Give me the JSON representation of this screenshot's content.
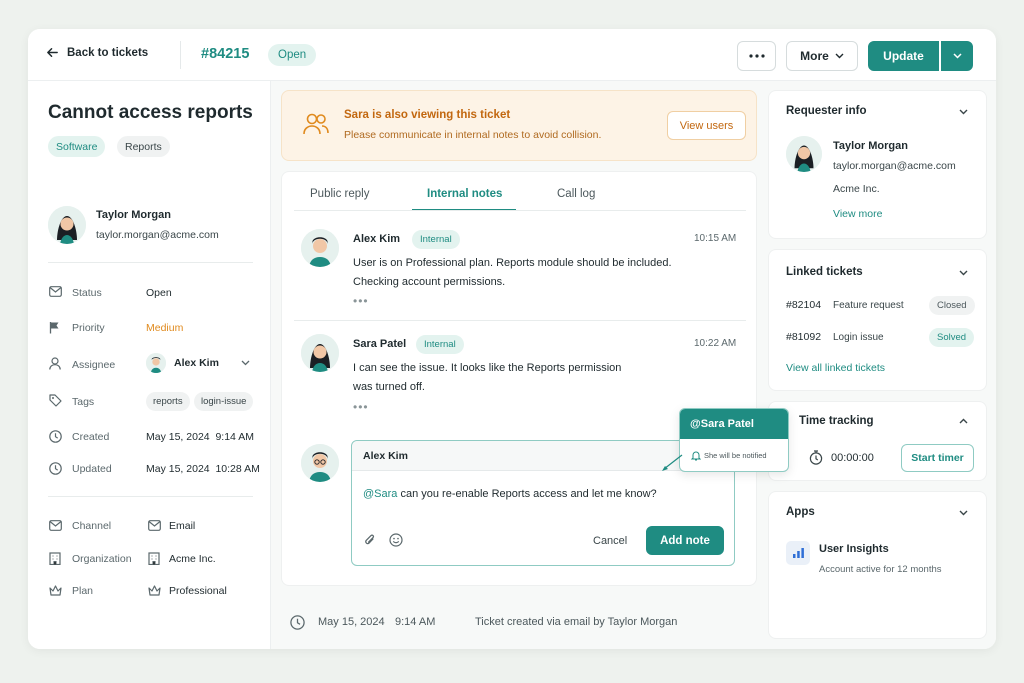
{
  "header": {
    "back_label": "Back to tickets",
    "ticket_id": "#84215",
    "status_badge": "Open",
    "more_label": "More",
    "update_label": "Update"
  },
  "ticket": {
    "title": "Cannot access reports",
    "tags": [
      "Software",
      "Reports"
    ],
    "requester_name": "Taylor Morgan",
    "requester_email": "taylor.morgan@acme.com"
  },
  "properties": {
    "status_label": "Status",
    "status_value": "Open",
    "priority_label": "Priority",
    "priority_value": "Medium",
    "assignee_label": "Assignee",
    "assignee_value": "Alex Kim",
    "tags_label": "Tags",
    "tag_values": [
      "reports",
      "login-issue"
    ],
    "created_label": "Created",
    "created_value": "May 15, 2024  9:14 AM",
    "updated_label": "Updated",
    "updated_value": "May 15, 2024  10:28 AM",
    "channel_label": "Channel",
    "channel_value": "Email",
    "organization_label": "Organization",
    "organization_value": "Acme Inc.",
    "plan_label": "Plan",
    "plan_value": "Professional"
  },
  "banner": {
    "title": "Sara is also viewing this ticket",
    "subtitle": "Please communicate in internal notes to avoid collision.",
    "button": "View users"
  },
  "tabs": [
    "Public reply",
    "Internal notes",
    "Call log"
  ],
  "messages": [
    {
      "author": "Alex Kim",
      "badge": "Internal",
      "time": "10:15 AM",
      "line1": "User is on Professional plan. Reports module should be included.",
      "line2": "Checking account permissions."
    },
    {
      "author": "Sara Patel",
      "badge": "Internal",
      "time": "10:22 AM",
      "line1": "I can see the issue. It looks like the Reports permission",
      "line2": "was turned off."
    }
  ],
  "composer": {
    "author": "Alex Kim",
    "mention": "@Sara",
    "text": " can you re-enable Reports access and let me know?",
    "cancel": "Cancel",
    "submit": "Add note"
  },
  "mention_popup": {
    "name": "@Sara Patel",
    "note": "She will be notified"
  },
  "footer": {
    "date": "May 15, 2024",
    "time": "9:14 AM",
    "text": "Ticket created via email by Taylor Morgan"
  },
  "requester_info": {
    "title": "Requester info",
    "name": "Taylor Morgan",
    "email": "taylor.morgan@acme.com",
    "company": "Acme Inc.",
    "link": "View more"
  },
  "linked_tickets": {
    "title": "Linked tickets",
    "items": [
      {
        "id": "#82104",
        "name": "Feature request",
        "status": "Closed"
      },
      {
        "id": "#81092",
        "name": "Login issue",
        "status": "Solved"
      }
    ],
    "link": "View all linked tickets"
  },
  "time_tracking": {
    "title": "Time tracking",
    "timer": "00:00:00",
    "button": "Start timer"
  },
  "apps": {
    "title": "Apps",
    "app_name": "User Insights",
    "app_desc": "Account active for 12 months"
  },
  "colors": {
    "accent": "#1f8c82",
    "priority_medium": "#e08a1e",
    "banner_bg": "#fdf3e6"
  }
}
